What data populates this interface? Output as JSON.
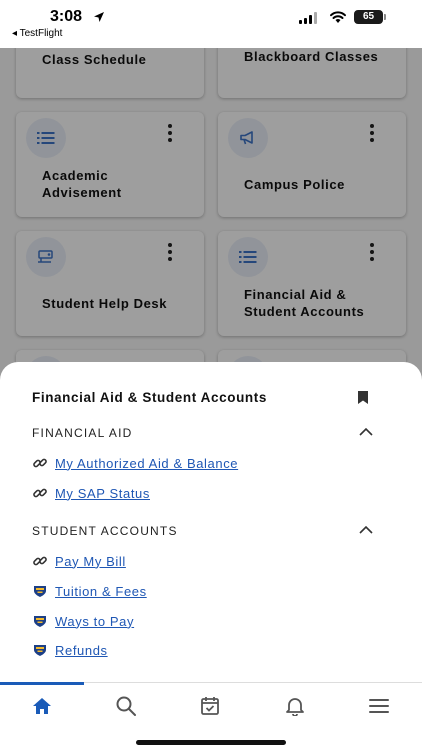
{
  "status_bar": {
    "time": "3:08",
    "back_app": "◂ TestFlight",
    "battery": "65"
  },
  "cards": [
    {
      "label": "Class Schedule",
      "icon": "list-icon"
    },
    {
      "label": "Blackboard Classes",
      "icon": "list-icon"
    },
    {
      "label": "Academic Advisement",
      "icon": "list-icon"
    },
    {
      "label": "Campus Police",
      "icon": "megaphone-icon"
    },
    {
      "label": "Student Help Desk",
      "icon": "help-desk-icon"
    },
    {
      "label": "Financial Aid & Student Accounts",
      "icon": "list-icon"
    }
  ],
  "sheet": {
    "title": "Financial Aid & Student Accounts",
    "sections": [
      {
        "heading": "FINANCIAL AID",
        "links": [
          {
            "label": "My Authorized Aid & Balance",
            "icon": "link-icon"
          },
          {
            "label": "My SAP Status",
            "icon": "link-icon"
          }
        ]
      },
      {
        "heading": "STUDENT ACCOUNTS",
        "links": [
          {
            "label": "Pay My Bill",
            "icon": "link-icon"
          },
          {
            "label": "Tuition & Fees",
            "icon": "shield-logo-icon"
          },
          {
            "label": "Ways to Pay",
            "icon": "shield-logo-icon"
          },
          {
            "label": "Refunds",
            "icon": "shield-logo-icon"
          }
        ]
      }
    ]
  },
  "tabbar": {
    "tabs": [
      "home-icon",
      "search-icon",
      "calendar-check-icon",
      "bell-icon",
      "menu-icon"
    ],
    "active": "home-icon"
  },
  "colors": {
    "accent": "#1a5bb8",
    "link": "#1f57b4",
    "overlay": "rgba(0,0,0,0.36)"
  }
}
